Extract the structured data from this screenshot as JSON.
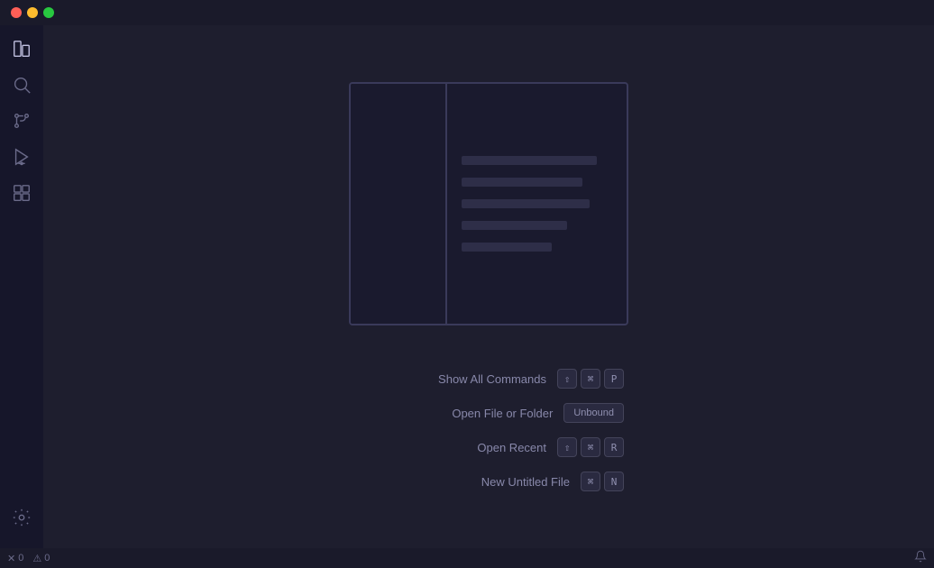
{
  "titlebar": {
    "traffic_lights": {
      "close": "close",
      "minimize": "minimize",
      "maximize": "maximize"
    }
  },
  "activity_bar": {
    "icons": [
      {
        "name": "explorer-icon",
        "label": "Explorer",
        "active": true
      },
      {
        "name": "search-icon",
        "label": "Search",
        "active": false
      },
      {
        "name": "source-control-icon",
        "label": "Source Control",
        "active": false
      },
      {
        "name": "run-debug-icon",
        "label": "Run and Debug",
        "active": false
      },
      {
        "name": "extensions-icon",
        "label": "Extensions",
        "active": false
      }
    ],
    "bottom_icons": [
      {
        "name": "settings-icon",
        "label": "Settings",
        "active": false
      }
    ]
  },
  "shortcuts": [
    {
      "label": "Show All Commands",
      "keys": [
        "⇧",
        "⌘",
        "P"
      ],
      "type": "keys"
    },
    {
      "label": "Open File or Folder",
      "keys": [
        "Unbound"
      ],
      "type": "unbound"
    },
    {
      "label": "Open Recent",
      "keys": [
        "⇧",
        "⌘",
        "R"
      ],
      "type": "keys"
    },
    {
      "label": "New Untitled File",
      "keys": [
        "⌘",
        "N"
      ],
      "type": "keys"
    }
  ],
  "status_bar": {
    "errors": "0",
    "warnings": "0",
    "bell": "notifications"
  }
}
